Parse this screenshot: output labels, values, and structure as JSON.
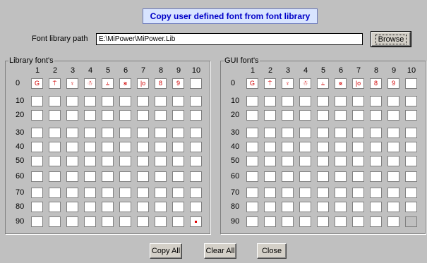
{
  "title": "Copy user defined font from font library",
  "path": {
    "label": "Font library path",
    "value": "E:\\MiPower\\MiPower.Lib"
  },
  "browse_label": "Browse",
  "library_group": {
    "label": "Library font's"
  },
  "gui_group": {
    "label": "GUI font's"
  },
  "col_headers": [
    "1",
    "2",
    "3",
    "4",
    "5",
    "6",
    "7",
    "8",
    "9",
    "10"
  ],
  "row_headers": [
    "0",
    "10",
    "20",
    "30",
    "40",
    "50",
    "60",
    "70",
    "80",
    "90"
  ],
  "glyph_row0": [
    "G",
    "⍑",
    "♀",
    "☃",
    "⫨",
    "⨳",
    "|o",
    "8",
    "9",
    ""
  ],
  "buttons": {
    "copy_all": "Copy All",
    "clear_all": "Clear All",
    "close": "Close"
  }
}
